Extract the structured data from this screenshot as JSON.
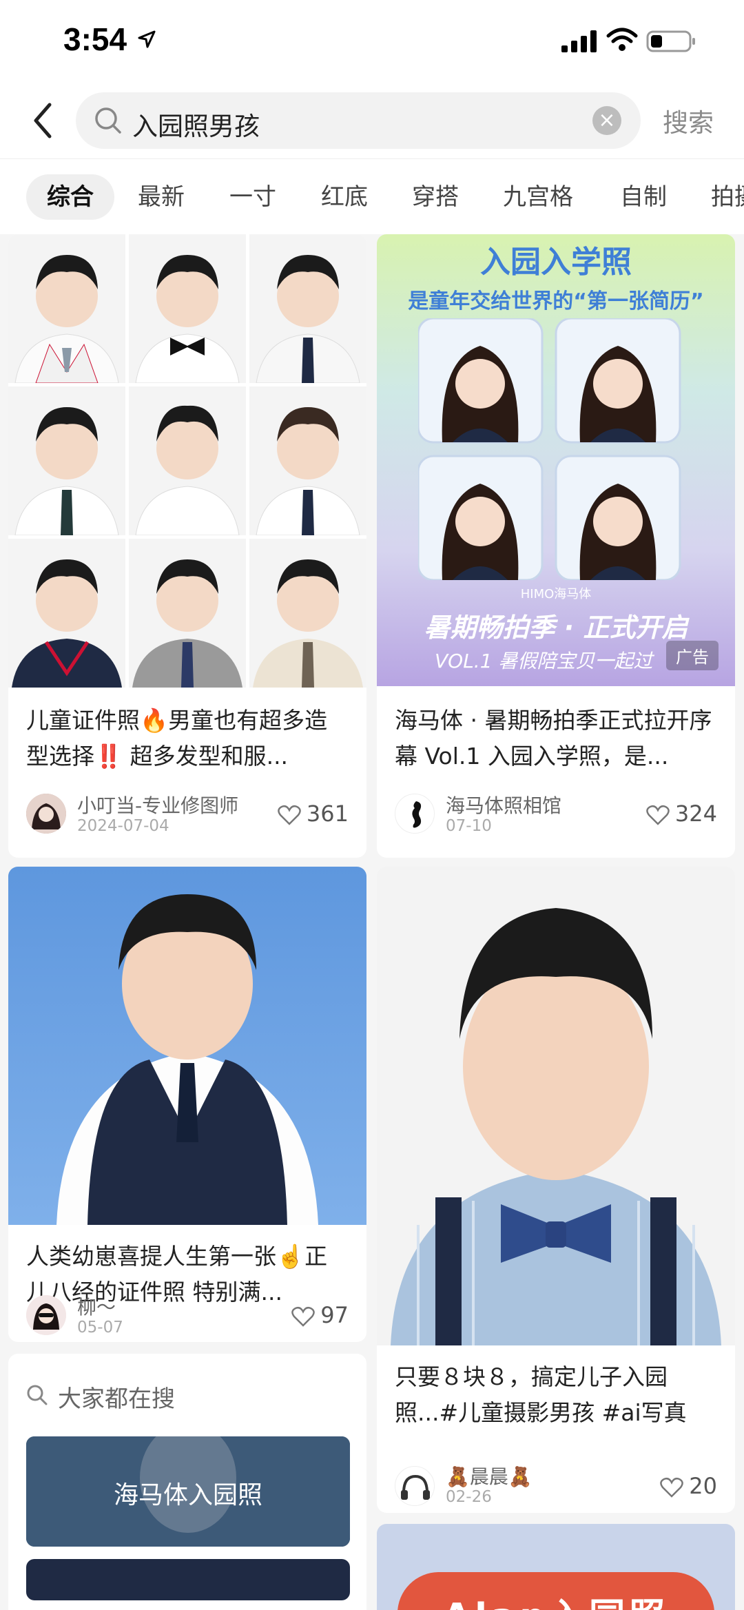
{
  "status_bar": {
    "time": "3:54"
  },
  "search": {
    "query": "入园照男孩",
    "button_label": "搜索"
  },
  "tabs": [
    "综合",
    "最新",
    "一寸",
    "红底",
    "穿搭",
    "九宫格",
    "自制",
    "拍摄"
  ],
  "posts": [
    {
      "title": "儿童证件照🔥男童也有超多造型选择‼️ 超多发型和服...",
      "author": "小叮当-专业修图师",
      "date": "2024-07-04",
      "likes": "361"
    },
    {
      "title": "海马体 · 暑期畅拍季正式拉开序幕 Vol.1 入园入学照，是...",
      "author": "海马体照相馆",
      "date": "07-10",
      "likes": "324",
      "ad": "广告",
      "banner": {
        "heading": "入园入学照",
        "subheading": "是童年交给世界的“第一张简历”",
        "brand": "HIMO海马体",
        "slogan": "暑期畅拍季 · 正式开启",
        "vol": "VOL.1 暑假陪宝贝一起过"
      }
    },
    {
      "title": "人类幼崽喜提人生第一张☝️正儿八经的证件照 特别满...",
      "author": "柳～",
      "date": "05-07",
      "likes": "97"
    },
    {
      "title": "只要８块８，搞定儿子入园照...#儿童摄影男孩 #ai写真",
      "author": "🧸晨晨🧸",
      "date": "02-26",
      "likes": "20"
    }
  ],
  "suggestions": {
    "title": "大家都在搜",
    "items": [
      "海马体入园照"
    ]
  },
  "partial_card": {
    "text": "Alan入园照"
  },
  "colors": {
    "accent_blue": "#5a8fd8",
    "navy": "#1f2a44"
  }
}
